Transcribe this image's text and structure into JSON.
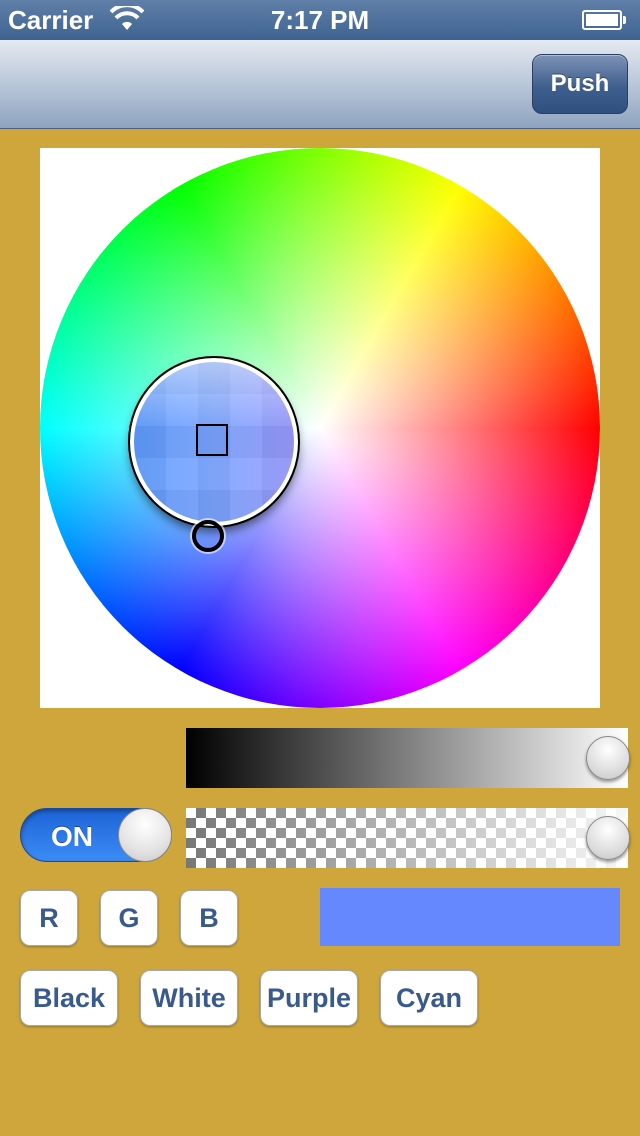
{
  "status_bar": {
    "carrier": "Carrier",
    "time": "7:17 PM",
    "icons": [
      "wifi-icon",
      "battery-icon"
    ]
  },
  "nav_bar": {
    "push_label": "Push"
  },
  "color_picker": {
    "selected_color": "#6688ff",
    "brightness_level": 1.0,
    "alpha_level": 1.0
  },
  "toggle": {
    "label": "ON",
    "state": true
  },
  "channel_buttons": [
    "R",
    "G",
    "B"
  ],
  "preset_buttons": [
    "Black",
    "White",
    "Purple",
    "Cyan"
  ],
  "colors": {
    "background": "#cea63c",
    "nav_accent": "#3f5f8e",
    "button_text": "#3b5a8c",
    "toggle_on": "#2f7ff0"
  }
}
